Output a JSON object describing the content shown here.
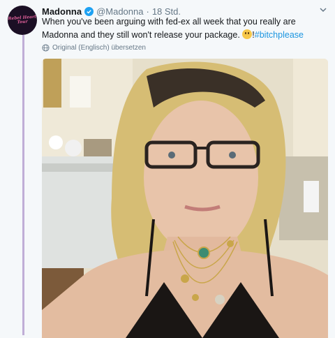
{
  "tweet": {
    "name": "Madonna",
    "handle": "@Madonna",
    "separator": "·",
    "time": "18 Std.",
    "text_main": "When you've been arguing with fed-ex all week that you really are Madonna and they still won't release your package.",
    "text_after_emoji": "!",
    "hashtag": "#bitchplease",
    "translate_label": "Original (Englisch) übersetzen",
    "avatar_text": "Rebel Heart Tour"
  },
  "colors": {
    "link": "#1b95e0",
    "verified": "#1da1f2",
    "thread_line": "#c0aed6",
    "muted": "#657786"
  },
  "icons": [
    "verified-badge-icon",
    "chevron-down-icon",
    "globe-icon",
    "smiley-emoji-icon"
  ]
}
